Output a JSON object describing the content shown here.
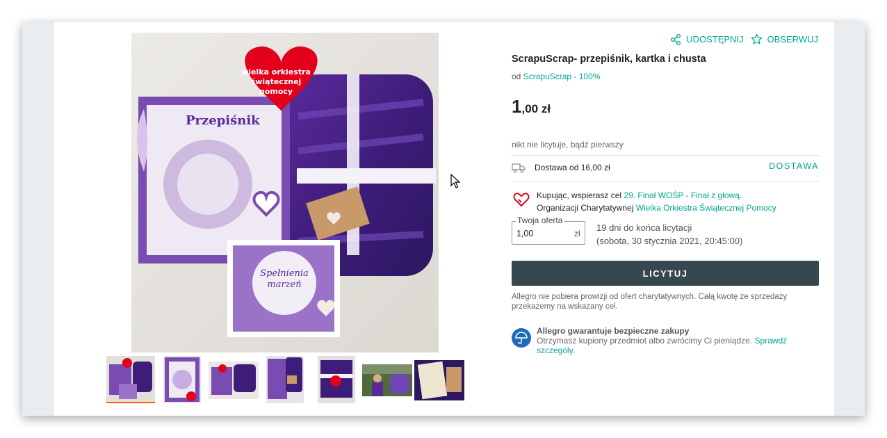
{
  "actions": {
    "share": "UDOSTĘPNIJ",
    "watch": "OBSERWUJ"
  },
  "product": {
    "title": "ScrapuScrap- przepiśnik, kartka i chusta",
    "seller_prefix": "od",
    "seller_name": "ScrapuScrap - 100%",
    "price_int": "1",
    "price_rest": ",00 zł"
  },
  "image": {
    "heart_sticker": [
      "wielka orkiestra",
      "świątecznej",
      "pomocy"
    ],
    "notebook_label": "Przepiśnik",
    "card_label": [
      "Spełnienia",
      "marzeń"
    ]
  },
  "thumbnails_count": 7,
  "bids": {
    "status": "nikt nie licytuje, bądź pierwszy"
  },
  "delivery": {
    "text": "Dostawa od 16,00 zł",
    "link": "DOSTAWA"
  },
  "charity": {
    "line1_prefix": "Kupując, wspierasz cel ",
    "goal": "29. Finał WOŚP - Finał z głową.",
    "line2_prefix": "Organizacji Charytatywnej ",
    "organization": "Wielka Orkiestra Świątecznej Pomocy"
  },
  "offer": {
    "legend": "Twoja oferta",
    "value": "1,00",
    "unit": "zł",
    "days_left": "19 dni do końca licytacji",
    "end_date": "(sobota, 30 stycznia 2021, 20:45:00)"
  },
  "bid_button": "LICYTUJ",
  "note": "Allegro nie pobiera prowizji od ofert charytatywnych. Całą kwotę ze sprzedaży przekażemy na wskazany cel.",
  "guarantee": {
    "title": "Allegro gwarantuje bezpieczne zakupy",
    "text": "Otrzymasz kupiony przedmiot albo zwrócimy Ci pieniądze. ",
    "link": "Sprawdź szczegóły",
    "suffix": "."
  },
  "colors": {
    "accent": "#00a790",
    "button": "#37474f",
    "active_thumb": "#ff5a00",
    "heart": "#e3001b"
  }
}
